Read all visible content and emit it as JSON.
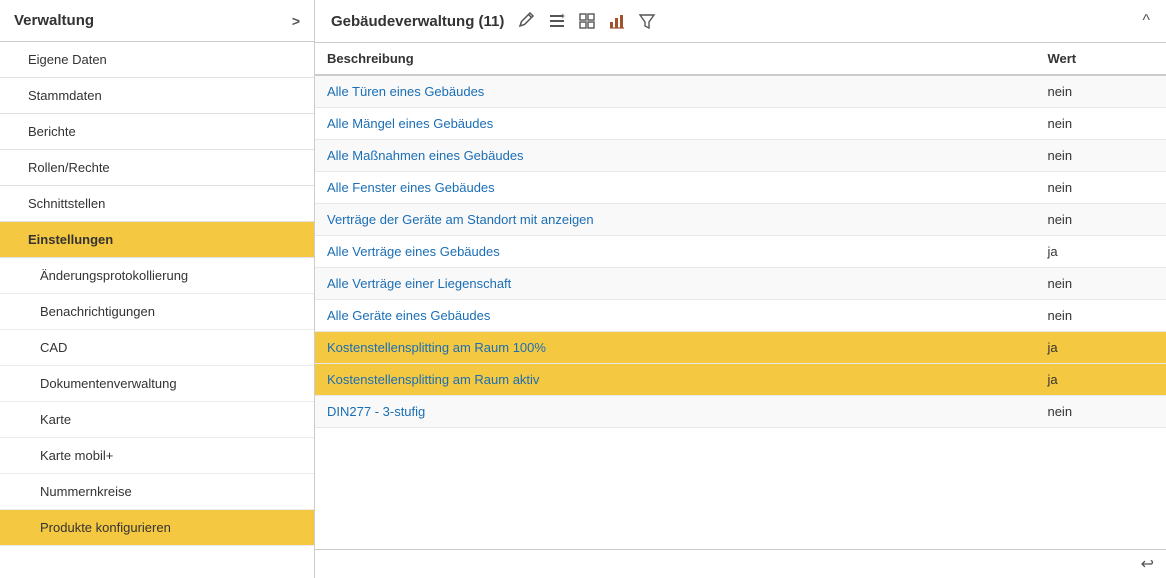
{
  "sidebar": {
    "header": "Verwaltung",
    "chevron_label": ">",
    "items": [
      {
        "id": "eigene-daten",
        "label": "Eigene Daten",
        "level": "top",
        "active": false
      },
      {
        "id": "stammdaten",
        "label": "Stammdaten",
        "level": "top",
        "active": false
      },
      {
        "id": "berichte",
        "label": "Berichte",
        "level": "top",
        "active": false
      },
      {
        "id": "rollen-rechte",
        "label": "Rollen/Rechte",
        "level": "top",
        "active": false
      },
      {
        "id": "schnittstellen",
        "label": "Schnittstellen",
        "level": "top",
        "active": false
      },
      {
        "id": "einstellungen",
        "label": "Einstellungen",
        "level": "top",
        "active": true
      },
      {
        "id": "aenderungsprotokollierung",
        "label": "Änderungsprotokollierung",
        "level": "sub",
        "active": false
      },
      {
        "id": "benachrichtigungen",
        "label": "Benachrichtigungen",
        "level": "sub",
        "active": false
      },
      {
        "id": "cad",
        "label": "CAD",
        "level": "sub",
        "active": false
      },
      {
        "id": "dokumentenverwaltung",
        "label": "Dokumentenverwaltung",
        "level": "sub",
        "active": false
      },
      {
        "id": "karte",
        "label": "Karte",
        "level": "sub",
        "active": false
      },
      {
        "id": "karte-mobil",
        "label": "Karte mobil+",
        "level": "sub",
        "active": false
      },
      {
        "id": "nummernkreise",
        "label": "Nummernkreise",
        "level": "sub",
        "active": false
      },
      {
        "id": "produkte-konfigurieren",
        "label": "Produkte konfigurieren",
        "level": "sub",
        "active": true
      }
    ]
  },
  "main": {
    "title": "Gebäudeverwaltung (11)",
    "collapse_label": "^",
    "columns": {
      "desc": "Beschreibung",
      "val": "Wert"
    },
    "rows": [
      {
        "id": "row1",
        "desc": "Alle Türen eines Gebäudes",
        "val": "nein",
        "highlighted": false
      },
      {
        "id": "row2",
        "desc": "Alle Mängel eines Gebäudes",
        "val": "nein",
        "highlighted": false
      },
      {
        "id": "row3",
        "desc": "Alle Maßnahmen eines Gebäudes",
        "val": "nein",
        "highlighted": false
      },
      {
        "id": "row4",
        "desc": "Alle Fenster eines Gebäudes",
        "val": "nein",
        "highlighted": false
      },
      {
        "id": "row5",
        "desc": "Verträge der Geräte am Standort mit anzeigen",
        "val": "nein",
        "highlighted": false
      },
      {
        "id": "row6",
        "desc": "Alle Verträge eines Gebäudes",
        "val": "ja",
        "highlighted": false
      },
      {
        "id": "row7",
        "desc": "Alle Verträge einer Liegenschaft",
        "val": "nein",
        "highlighted": false
      },
      {
        "id": "row8",
        "desc": "Alle Geräte eines Gebäudes",
        "val": "nein",
        "highlighted": false
      },
      {
        "id": "row9",
        "desc": "Kostenstellensplitting am Raum 100%",
        "val": "ja",
        "highlighted": true
      },
      {
        "id": "row10",
        "desc": "Kostenstellensplitting am Raum aktiv",
        "val": "ja",
        "highlighted": true
      },
      {
        "id": "row11",
        "desc": "DIN277 - 3-stufig",
        "val": "nein",
        "highlighted": false
      }
    ],
    "footer_icon": "↩"
  }
}
